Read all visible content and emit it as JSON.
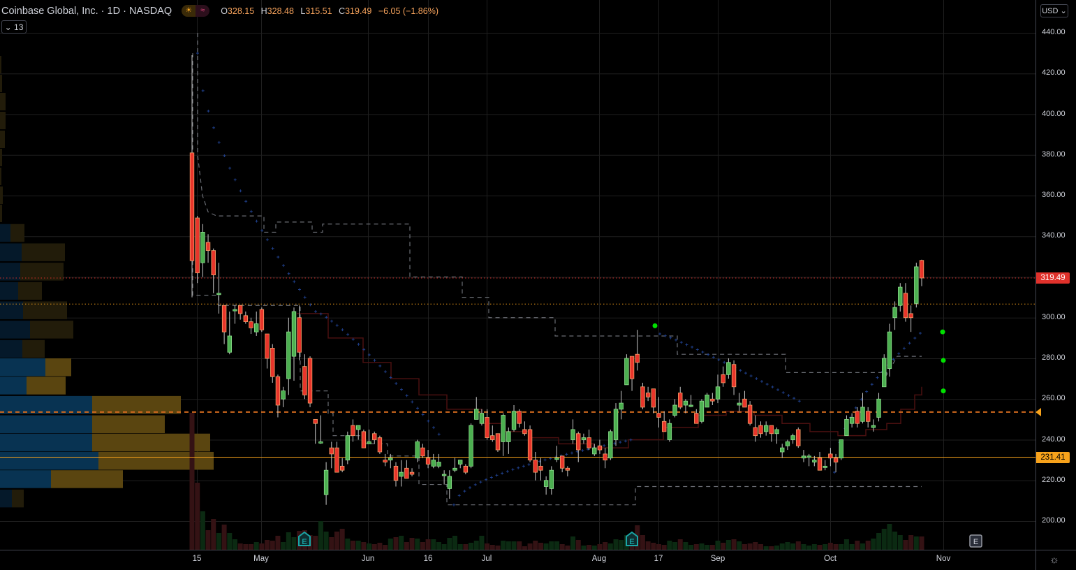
{
  "header": {
    "symbol_title": "Coinbase Global, Inc. · 1D · NASDAQ",
    "icons": [
      "market-hours-icon",
      "data-delay-icon"
    ],
    "ohlc": {
      "o_label": "O",
      "o": "328.15",
      "h_label": "H",
      "h": "328.48",
      "l_label": "L",
      "l": "315.51",
      "c_label": "C",
      "c": "319.49",
      "change": "−6.05 (−1.86%)"
    },
    "indicators_collapsed_count": "13"
  },
  "currency": "USD",
  "price_axis": {
    "labels": [
      "440.00",
      "420.00",
      "400.00",
      "380.00",
      "360.00",
      "340.00",
      "300.00",
      "280.00",
      "260.00",
      "240.00",
      "220.00",
      "200.00"
    ],
    "last_price": "319.49",
    "marker_price": "231.41"
  },
  "time_axis": {
    "labels": [
      "15",
      "May",
      "Jun",
      "16",
      "Jul",
      "Aug",
      "17",
      "Sep",
      "Oct",
      "Nov"
    ]
  },
  "earnings_marker_label": "E",
  "colors": {
    "up": "#4caf50",
    "down": "#e8352b",
    "last_price": "#e0312b",
    "marker": "#f7a21b",
    "sar": "#1f3f8a",
    "volume_up": "#0b2a12",
    "volume_down": "#341214"
  },
  "chart_data": {
    "type": "candlestick",
    "title": "Coinbase Global, Inc. · 1D · NASDAQ",
    "ylim": [
      190,
      445
    ],
    "y_ticks": [
      200,
      220,
      240,
      260,
      280,
      300,
      320,
      340,
      360,
      380,
      400,
      420,
      440
    ],
    "candles_ohlc": [
      [
        381,
        429,
        310,
        328
      ],
      [
        349,
        350,
        317,
        322
      ],
      [
        327,
        346,
        320,
        342
      ],
      [
        337,
        341,
        327,
        333
      ],
      [
        333,
        334,
        312,
        321
      ],
      [
        312,
        327,
        302,
        312
      ],
      [
        306,
        306,
        287,
        293
      ],
      [
        283,
        303,
        282,
        291
      ],
      [
        304,
        306,
        297,
        304
      ],
      [
        306,
        306,
        299,
        302
      ],
      [
        301,
        303,
        297,
        298
      ],
      [
        298,
        300,
        292,
        295
      ],
      [
        293,
        303,
        291,
        297
      ],
      [
        304,
        305,
        293,
        294
      ],
      [
        292,
        292,
        275,
        280
      ],
      [
        285,
        287,
        268,
        271
      ],
      [
        271,
        272,
        251,
        257
      ],
      [
        260,
        266,
        256,
        264
      ],
      [
        270,
        300,
        262,
        293
      ],
      [
        281,
        305,
        269,
        303
      ],
      [
        300,
        306,
        279,
        283
      ],
      [
        276,
        282,
        260,
        262
      ],
      [
        280,
        281,
        256,
        258
      ],
      [
        250,
        250,
        238,
        248
      ],
      [
        239,
        252,
        238,
        239
      ],
      [
        213,
        229,
        208,
        225
      ],
      [
        236,
        239,
        226,
        233
      ],
      [
        236,
        239,
        224,
        224
      ],
      [
        227,
        231,
        224,
        225
      ],
      [
        230,
        244,
        228,
        242
      ],
      [
        247,
        250,
        239,
        242
      ],
      [
        245,
        247,
        240,
        247
      ],
      [
        244,
        245,
        236,
        236
      ],
      [
        238,
        245,
        238,
        239
      ],
      [
        243,
        244,
        238,
        240
      ],
      [
        241,
        242,
        233,
        234
      ],
      [
        230,
        233,
        227,
        229
      ],
      [
        230,
        233,
        226,
        231
      ],
      [
        227,
        229,
        217,
        220
      ],
      [
        222,
        230,
        217,
        224
      ],
      [
        226,
        230,
        221,
        221
      ],
      [
        224,
        226,
        222,
        223
      ],
      [
        231,
        240,
        229,
        239
      ],
      [
        236,
        238,
        231,
        232
      ],
      [
        231,
        235,
        226,
        228
      ],
      [
        227,
        233,
        226,
        230
      ],
      [
        227,
        233,
        226,
        229
      ],
      [
        223,
        225,
        218,
        223
      ],
      [
        216,
        225,
        211,
        222
      ],
      [
        225,
        231,
        224,
        226
      ],
      [
        228,
        230,
        226,
        230
      ],
      [
        227,
        228,
        223,
        224
      ],
      [
        227,
        248,
        226,
        247
      ],
      [
        250,
        261,
        250,
        255
      ],
      [
        248,
        255,
        247,
        253
      ],
      [
        251,
        255,
        240,
        241
      ],
      [
        242,
        247,
        239,
        240
      ],
      [
        243,
        243,
        234,
        235
      ],
      [
        239,
        253,
        232,
        252
      ],
      [
        239,
        246,
        233,
        244
      ],
      [
        245,
        257,
        244,
        254
      ],
      [
        254,
        255,
        246,
        248
      ],
      [
        245,
        249,
        242,
        243
      ],
      [
        245,
        247,
        229,
        230
      ],
      [
        230,
        234,
        220,
        224
      ],
      [
        227,
        231,
        220,
        225
      ],
      [
        217,
        222,
        213,
        220
      ],
      [
        216,
        227,
        213,
        225
      ],
      [
        231,
        237,
        229,
        231
      ],
      [
        232,
        232,
        224,
        226
      ],
      [
        226,
        227,
        222,
        225
      ],
      [
        240,
        250,
        238,
        245
      ],
      [
        243,
        244,
        229,
        235
      ],
      [
        240,
        243,
        238,
        241
      ],
      [
        241,
        245,
        235,
        236
      ],
      [
        233,
        238,
        232,
        236
      ],
      [
        237,
        240,
        233,
        235
      ],
      [
        233,
        236,
        226,
        230
      ],
      [
        231,
        245,
        230,
        244
      ],
      [
        240,
        258,
        237,
        255
      ],
      [
        255,
        264,
        250,
        258
      ],
      [
        267,
        282,
        267,
        280
      ],
      [
        281,
        281,
        264,
        270
      ],
      [
        282,
        294,
        274,
        278
      ],
      [
        266,
        268,
        255,
        256
      ],
      [
        263,
        266,
        259,
        261
      ],
      [
        265,
        265,
        253,
        256
      ],
      [
        253,
        261,
        246,
        251
      ],
      [
        249,
        254,
        244,
        244
      ],
      [
        240,
        250,
        239,
        248
      ],
      [
        252,
        260,
        251,
        257
      ],
      [
        263,
        266,
        255,
        256
      ],
      [
        257,
        260,
        253,
        259
      ],
      [
        257,
        262,
        256,
        257
      ],
      [
        253,
        255,
        248,
        248
      ],
      [
        249,
        260,
        248,
        259
      ],
      [
        256,
        263,
        256,
        262
      ],
      [
        260,
        263,
        257,
        259
      ],
      [
        260,
        272,
        258,
        266
      ],
      [
        272,
        276,
        266,
        268
      ],
      [
        272,
        280,
        270,
        278
      ],
      [
        277,
        279,
        262,
        266
      ],
      [
        257,
        263,
        254,
        258
      ],
      [
        260,
        264,
        256,
        256
      ],
      [
        257,
        259,
        247,
        248
      ],
      [
        246,
        252,
        239,
        242
      ],
      [
        247,
        249,
        241,
        243
      ],
      [
        244,
        249,
        242,
        247
      ],
      [
        247,
        247,
        239,
        243
      ],
      [
        243,
        246,
        238,
        245
      ],
      [
        234,
        238,
        231,
        236
      ],
      [
        237,
        240,
        235,
        239
      ],
      [
        240,
        243,
        238,
        242
      ],
      [
        245,
        246,
        236,
        237
      ],
      [
        231,
        235,
        229,
        232
      ],
      [
        232,
        233,
        227,
        232
      ],
      [
        229,
        232,
        227,
        230
      ],
      [
        231,
        234,
        225,
        225
      ],
      [
        227,
        230,
        225,
        227
      ],
      [
        233,
        236,
        227,
        231
      ],
      [
        231,
        233,
        224,
        229
      ],
      [
        231,
        240,
        230,
        240
      ],
      [
        242,
        252,
        242,
        250
      ],
      [
        248,
        253,
        246,
        251
      ],
      [
        254,
        256,
        246,
        248
      ],
      [
        249,
        263,
        248,
        256
      ],
      [
        254,
        256,
        246,
        249
      ],
      [
        246,
        250,
        244,
        247
      ],
      [
        251,
        263,
        249,
        260
      ],
      [
        266,
        282,
        266,
        280
      ],
      [
        275,
        297,
        271,
        293
      ],
      [
        300,
        308,
        294,
        305
      ],
      [
        306,
        317,
        303,
        315
      ],
      [
        312,
        317,
        298,
        300
      ],
      [
        302,
        306,
        293,
        300
      ],
      [
        307,
        327,
        305,
        325
      ],
      [
        328.15,
        328.48,
        315.51,
        319.49
      ]
    ],
    "volumes": [
      196,
      96,
      55,
      28,
      44,
      24,
      36,
      24,
      15,
      9,
      8,
      8,
      11,
      9,
      14,
      13,
      20,
      11,
      25,
      18,
      27,
      28,
      21,
      20,
      41,
      26,
      18,
      26,
      30,
      16,
      13,
      13,
      11,
      9,
      8,
      10,
      7,
      16,
      18,
      20,
      11,
      17,
      16,
      11,
      15,
      15,
      11,
      8,
      17,
      20,
      8,
      8,
      10,
      13,
      20,
      9,
      7,
      6,
      13,
      12,
      12,
      12,
      5,
      9,
      13,
      10,
      9,
      12,
      12,
      8,
      6,
      19,
      14,
      6,
      7,
      6,
      8,
      11,
      9,
      15,
      14,
      21,
      23,
      35,
      21,
      12,
      10,
      8,
      7,
      13,
      11,
      15,
      11,
      7,
      8,
      9,
      7,
      7,
      13,
      10,
      14,
      15,
      12,
      8,
      9,
      11,
      8,
      5,
      5,
      6,
      9,
      11,
      9,
      12,
      8,
      6,
      8,
      7,
      8,
      10,
      8,
      8,
      15,
      8,
      13,
      9,
      13,
      16,
      24,
      30,
      37,
      26,
      21,
      14,
      21,
      19,
      19
    ],
    "horizontal_lines": [
      {
        "price": 319.49,
        "style": "dotted",
        "color": "#e0312b"
      },
      {
        "price": 306.7,
        "style": "dotted",
        "color": "#f7a21b"
      },
      {
        "price": 253.6,
        "style": "dashed",
        "color": "#d2691e"
      },
      {
        "price": 231.41,
        "style": "solid",
        "color": "#f7a21b"
      }
    ],
    "volume_profile_rows": [
      {
        "top": 346,
        "up": 15,
        "down": 20,
        "in_value_area": false
      },
      {
        "top": 336.5,
        "up": 31,
        "down": 62,
        "in_value_area": false
      },
      {
        "top": 327,
        "up": 29,
        "down": 62,
        "in_value_area": false
      },
      {
        "top": 317.5,
        "up": 26,
        "down": 34,
        "in_value_area": false
      },
      {
        "top": 308,
        "up": 33,
        "down": 63,
        "in_value_area": false
      },
      {
        "top": 298.5,
        "up": 43,
        "down": 62,
        "in_value_area": false
      },
      {
        "top": 289,
        "up": 32,
        "down": 32,
        "in_value_area": false
      },
      {
        "top": 280,
        "up": 65,
        "down": 37,
        "in_value_area": true
      },
      {
        "top": 271,
        "up": 38,
        "down": 56,
        "in_value_area": true
      },
      {
        "top": 261.5,
        "up": 132,
        "down": 127,
        "in_value_area": true
      },
      {
        "top": 252,
        "up": 132,
        "down": 104,
        "in_value_area": true
      },
      {
        "top": 243,
        "up": 132,
        "down": 169,
        "in_value_area": true
      },
      {
        "top": 234,
        "up": 141,
        "down": 165,
        "in_value_area": true
      },
      {
        "top": 225,
        "up": 73,
        "down": 103,
        "in_value_area": true
      },
      {
        "top": 215.5,
        "up": 17,
        "down": 17,
        "in_value_area": false
      }
    ],
    "signal_dots_prices": [
      296,
      293,
      279,
      264
    ]
  }
}
